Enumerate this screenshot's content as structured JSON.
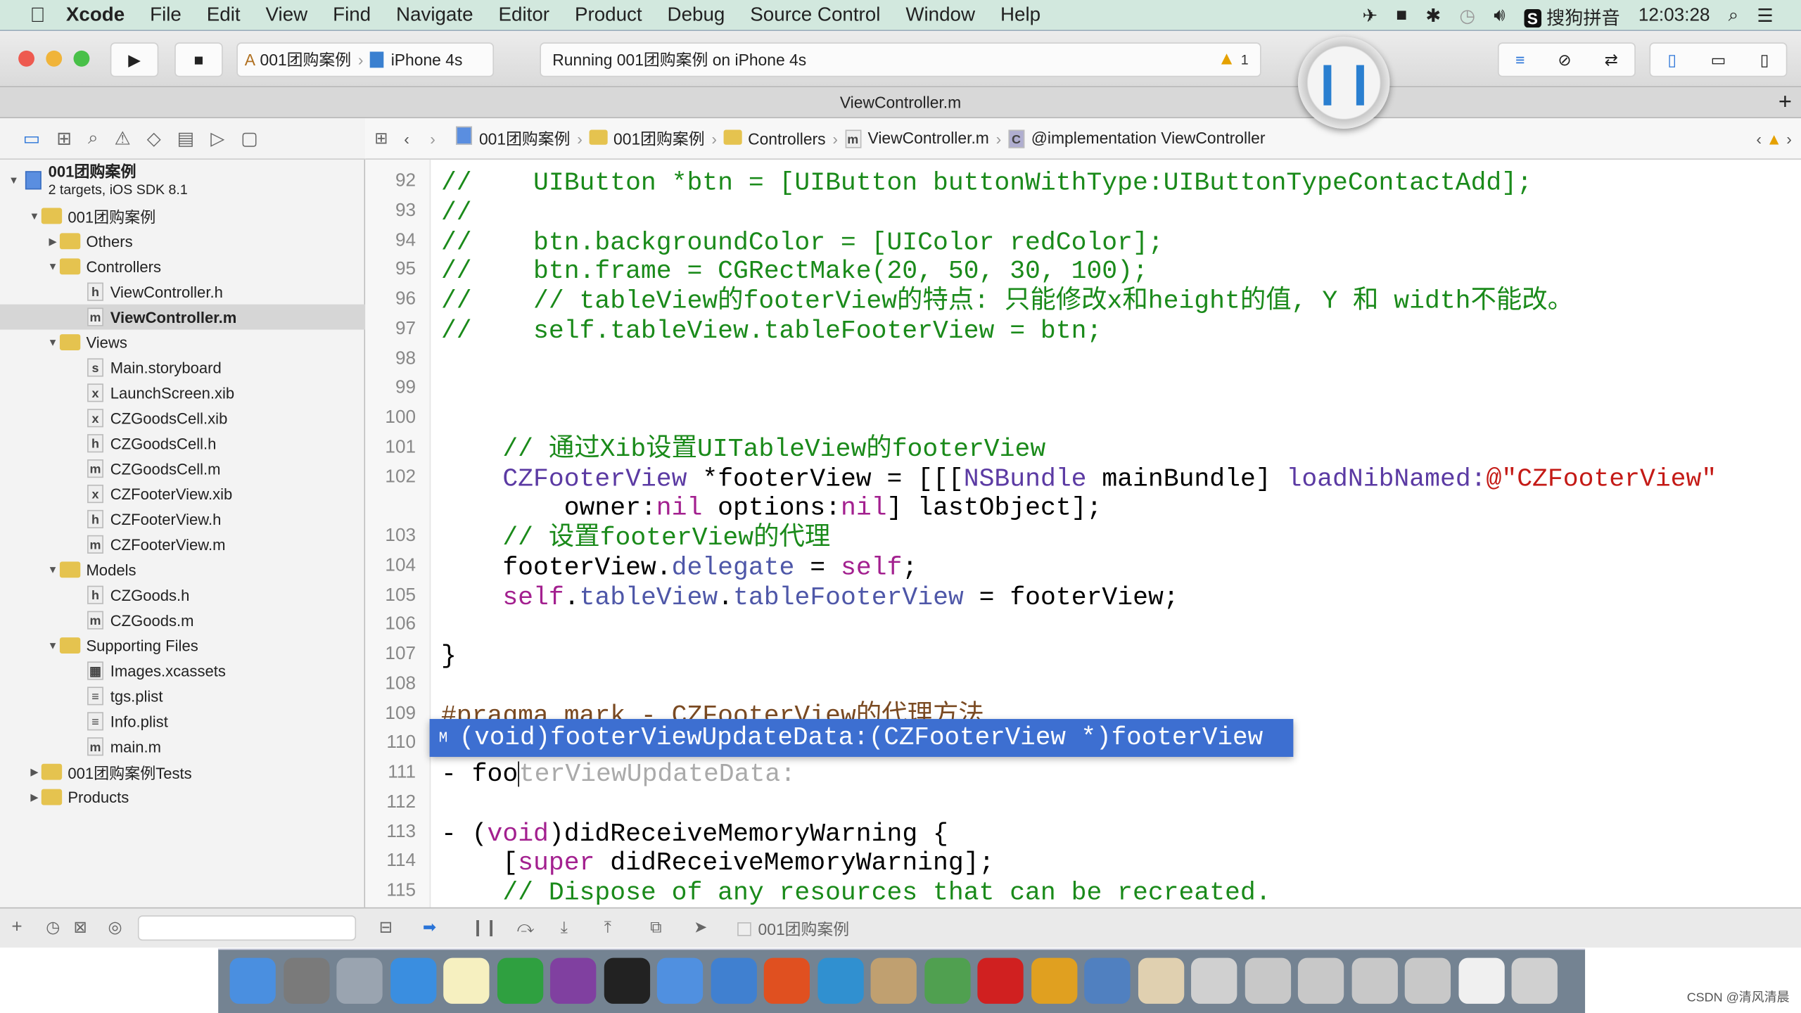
{
  "menubar": {
    "app": "Xcode",
    "items": [
      "File",
      "Edit",
      "View",
      "Find",
      "Navigate",
      "Editor",
      "Product",
      "Debug",
      "Source Control",
      "Window",
      "Help"
    ],
    "input_method": "搜狗拼音",
    "clock": "12:03:28"
  },
  "toolbar": {
    "scheme": "001团购案例",
    "device": "iPhone 4s",
    "activity": "Running 001团购案例 on iPhone 4s",
    "warnings": "1"
  },
  "tab": {
    "title": "ViewController.m"
  },
  "sidebar": {
    "project": "001团购案例",
    "project_sub": "2 targets, iOS SDK 8.1",
    "items": [
      {
        "label": "001团购案例",
        "type": "folder",
        "level": 1,
        "open": true
      },
      {
        "label": "Others",
        "type": "folder",
        "level": 2,
        "open": false
      },
      {
        "label": "Controllers",
        "type": "folder",
        "level": 2,
        "open": true
      },
      {
        "label": "ViewController.h",
        "type": "h",
        "level": 3
      },
      {
        "label": "ViewController.m",
        "type": "m",
        "level": 3,
        "selected": true
      },
      {
        "label": "Views",
        "type": "folder",
        "level": 2,
        "open": true
      },
      {
        "label": "Main.storyboard",
        "type": "sb",
        "level": 3
      },
      {
        "label": "LaunchScreen.xib",
        "type": "xib",
        "level": 3
      },
      {
        "label": "CZGoodsCell.xib",
        "type": "xib",
        "level": 3
      },
      {
        "label": "CZGoodsCell.h",
        "type": "h",
        "level": 3
      },
      {
        "label": "CZGoodsCell.m",
        "type": "m",
        "level": 3
      },
      {
        "label": "CZFooterView.xib",
        "type": "xib",
        "level": 3
      },
      {
        "label": "CZFooterView.h",
        "type": "h",
        "level": 3
      },
      {
        "label": "CZFooterView.m",
        "type": "m",
        "level": 3
      },
      {
        "label": "Models",
        "type": "folder",
        "level": 2,
        "open": true
      },
      {
        "label": "CZGoods.h",
        "type": "h",
        "level": 3
      },
      {
        "label": "CZGoods.m",
        "type": "m",
        "level": 3
      },
      {
        "label": "Supporting Files",
        "type": "folder",
        "level": 2,
        "open": true
      },
      {
        "label": "Images.xcassets",
        "type": "xc",
        "level": 3
      },
      {
        "label": "tgs.plist",
        "type": "plist",
        "level": 3
      },
      {
        "label": "Info.plist",
        "type": "plist",
        "level": 3
      },
      {
        "label": "main.m",
        "type": "m",
        "level": 3
      },
      {
        "label": "001团购案例Tests",
        "type": "folder",
        "level": 1,
        "open": false
      },
      {
        "label": "Products",
        "type": "folder",
        "level": 1,
        "open": false
      }
    ]
  },
  "jumpbar": [
    "001团购案例",
    "001团购案例",
    "Controllers",
    "ViewController.m",
    "@implementation ViewController"
  ],
  "code": [
    {
      "n": "92",
      "t": [
        [
          "//    UIButton *btn = [UIButton buttonWithType:UIButtonTypeContactAdd];",
          "com"
        ]
      ]
    },
    {
      "n": "93",
      "t": [
        [
          "//",
          "com"
        ]
      ]
    },
    {
      "n": "94",
      "t": [
        [
          "//    btn.backgroundColor = [UIColor redColor];",
          "com"
        ]
      ]
    },
    {
      "n": "95",
      "t": [
        [
          "//    btn.frame = CGRectMake(20, 50, 30, 100);",
          "com"
        ]
      ]
    },
    {
      "n": "96",
      "t": [
        [
          "//    // tableView的footerView的特点: 只能修改x和height的值, Y 和 width不能改。",
          "com"
        ]
      ]
    },
    {
      "n": "97",
      "t": [
        [
          "//    self.tableView.tableFooterView = btn;",
          "com"
        ]
      ]
    },
    {
      "n": "98",
      "t": []
    },
    {
      "n": "99",
      "t": []
    },
    {
      "n": "100",
      "t": []
    },
    {
      "n": "101",
      "t": [
        [
          "    // 通过Xib设置UITableView的footerView",
          "com"
        ]
      ]
    },
    {
      "n": "102",
      "t": [
        [
          "    ",
          ""
        ],
        [
          "CZFooterView",
          "cls"
        ],
        [
          " *footerView = [[[",
          ""
        ],
        [
          "NSBundle",
          "cls"
        ],
        [
          " mainBundle] ",
          ""
        ],
        [
          "loadNibNamed:",
          "cls"
        ],
        [
          "@\"CZFooterView\"",
          "str"
        ]
      ]
    },
    {
      "n": "",
      "t": [
        [
          "        owner:",
          ""
        ],
        [
          "nil",
          "kw"
        ],
        [
          " options:",
          ""
        ],
        [
          "nil",
          "kw"
        ],
        [
          "] lastObject];",
          ""
        ]
      ]
    },
    {
      "n": "103",
      "t": [
        [
          "    // 设置footerView的代理",
          "com"
        ]
      ]
    },
    {
      "n": "104",
      "t": [
        [
          "    footerView.",
          ""
        ],
        [
          "delegate",
          "prop"
        ],
        [
          " = ",
          ""
        ],
        [
          "self",
          "kw"
        ],
        [
          ";",
          ""
        ]
      ]
    },
    {
      "n": "105",
      "t": [
        [
          "    ",
          ""
        ],
        [
          "self",
          "kw"
        ],
        [
          ".",
          ""
        ],
        [
          "tableView",
          "prop"
        ],
        [
          ".",
          ""
        ],
        [
          "tableFooterView",
          "prop"
        ],
        [
          " = footerView;",
          ""
        ]
      ]
    },
    {
      "n": "106",
      "t": []
    },
    {
      "n": "107",
      "t": [
        [
          "}",
          ""
        ]
      ]
    },
    {
      "n": "108",
      "t": []
    },
    {
      "n": "109",
      "t": [
        [
          "#pragma mark - CZFooterView的代理方法",
          "pre"
        ]
      ]
    },
    {
      "n": "110",
      "t": []
    },
    {
      "n": "111",
      "t": [
        [
          "- foo",
          ""
        ],
        [
          "|caret",
          ""
        ],
        [
          "terViewUpdateData:",
          "ghost"
        ]
      ]
    },
    {
      "n": "112",
      "t": []
    },
    {
      "n": "113",
      "t": [
        [
          "- (",
          ""
        ],
        [
          "void",
          "kw"
        ],
        [
          ")didReceiveMemoryWarning {",
          ""
        ]
      ]
    },
    {
      "n": "114",
      "t": [
        [
          "    [",
          ""
        ],
        [
          "super",
          "kw"
        ],
        [
          " didReceiveMemoryWarning];",
          ""
        ]
      ]
    },
    {
      "n": "115",
      "t": [
        [
          "    // Dispose of any resources that can be recreated.",
          "com"
        ]
      ]
    }
  ],
  "completion": {
    "kind": "M",
    "text": "(void)footerViewUpdateData:(CZFooterView *)footerView"
  },
  "bottombar": {
    "target": "001团购案例"
  },
  "dock": {
    "colors": [
      "#4a8fe0",
      "#7a7a7a",
      "#9aa4b0",
      "#3a8ee0",
      "#f6f0c0",
      "#2fa040",
      "#8040a0",
      "#222",
      "#5090e0",
      "#4080d0",
      "#e05020",
      "#3090d0",
      "#c0a070",
      "#50a050",
      "#d02020",
      "#e0a020",
      "#5080c0",
      "#e0d0b0",
      "#d0d0d0",
      "#c8c8c8",
      "#c8c8c8",
      "#c8c8c8",
      "#c8c8c8",
      "#f0f0f0",
      "#d0d0d0"
    ]
  },
  "watermark": "CSDN @清风清晨"
}
